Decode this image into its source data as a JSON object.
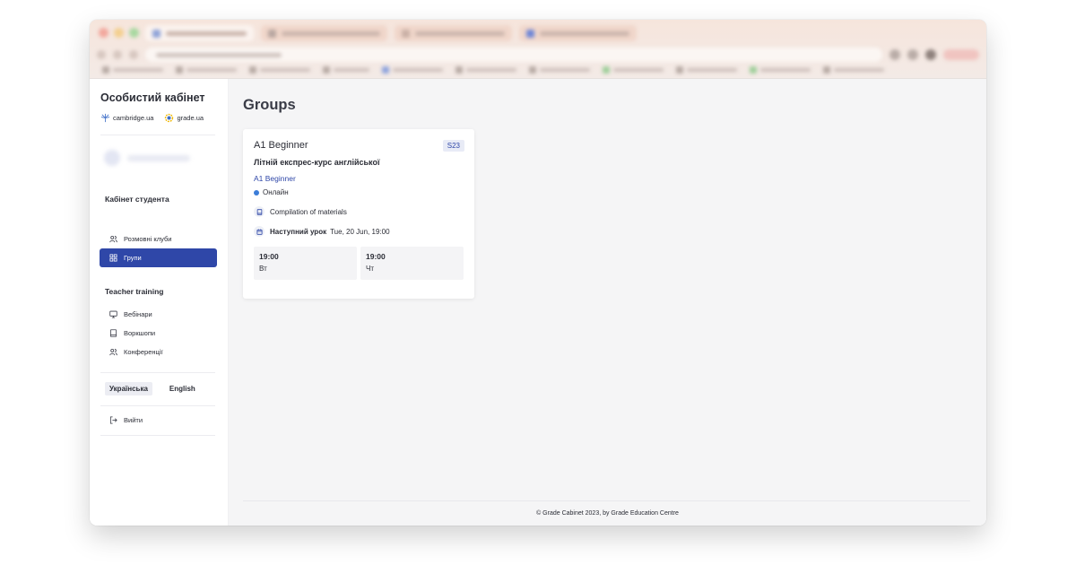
{
  "sidebar": {
    "title": "Особистий кабінет",
    "brands": [
      {
        "name": "cambridge.ua",
        "icon": "cambridge-logo-icon"
      },
      {
        "name": "grade.ua",
        "icon": "grade-logo-icon"
      }
    ],
    "sections": [
      {
        "heading": "Кабінет студента",
        "items": [
          {
            "label": "Розмовні клуби",
            "icon": "users-icon",
            "active": false
          },
          {
            "label": "Групи",
            "icon": "grid-icon",
            "active": true
          }
        ]
      },
      {
        "heading": "Teacher training",
        "items": [
          {
            "label": "Вебінари",
            "icon": "monitor-icon",
            "active": false
          },
          {
            "label": "Воркшопи",
            "icon": "book-icon",
            "active": false
          },
          {
            "label": "Конференції",
            "icon": "users-icon",
            "active": false
          }
        ]
      }
    ],
    "languages": [
      {
        "label": "Українська",
        "active": true
      },
      {
        "label": "English",
        "active": false
      }
    ],
    "logout_label": "Вийти"
  },
  "main": {
    "title": "Groups",
    "group_card": {
      "level": "A1 Beginner",
      "badge": "S23",
      "name": "Літній експрес-курс англійської",
      "subtitle": "A1 Beginner",
      "status": "Онлайн",
      "materials_label": "Compilation of materials",
      "next_lesson_label": "Наступний урок",
      "next_lesson_value": "Tue, 20 Jun, 19:00",
      "schedule": [
        {
          "time": "19:00",
          "day": "Вт"
        },
        {
          "time": "19:00",
          "day": "Чт"
        }
      ]
    },
    "footer": "© Grade Cabinet 2023, by Grade Education Centre"
  },
  "colors": {
    "accent": "#2f47a8",
    "status_online": "#3b7dd8",
    "background": "#f5f5f6"
  }
}
